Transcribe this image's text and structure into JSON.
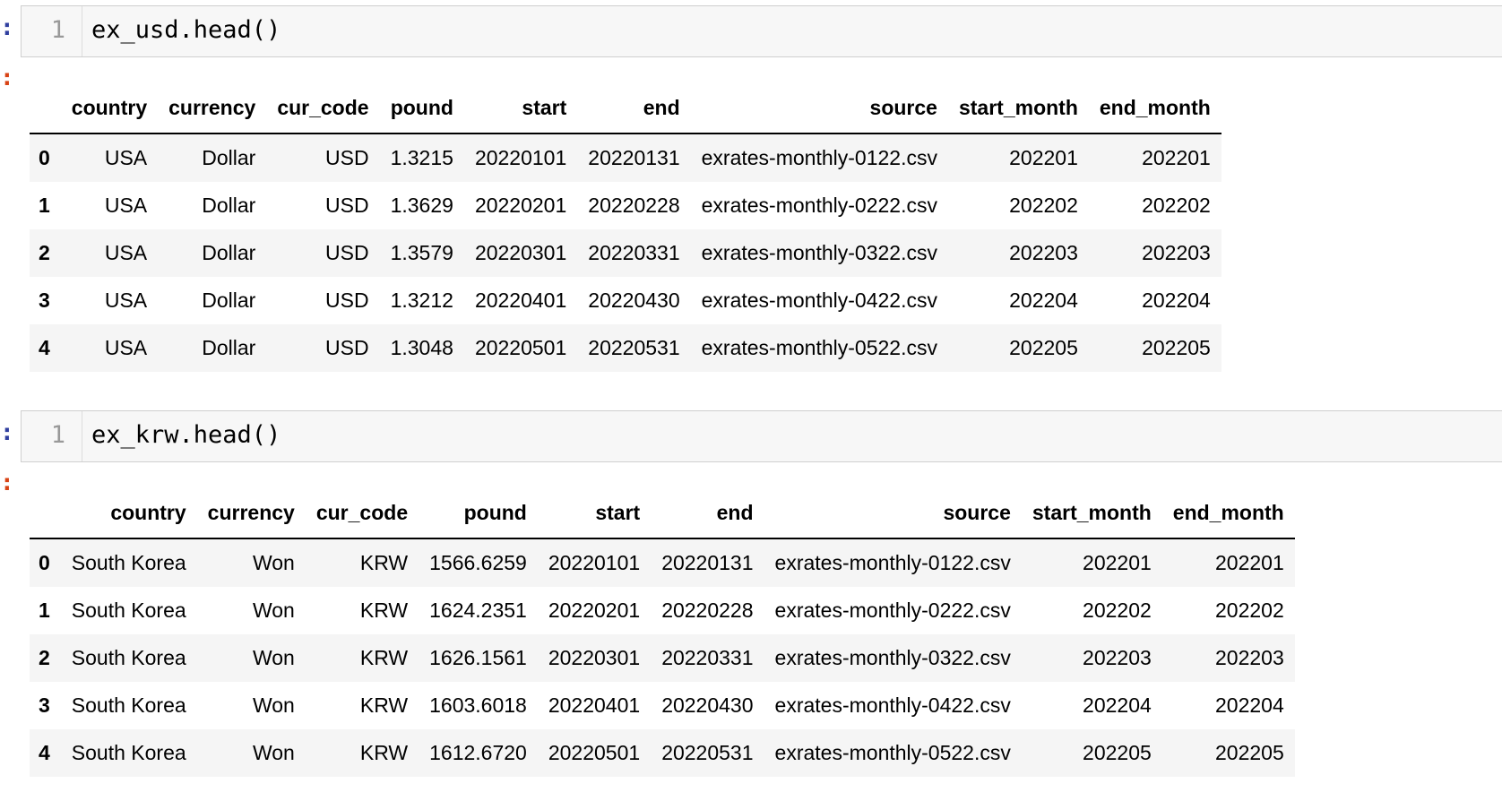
{
  "cells": [
    {
      "in_prompt": ":",
      "out_prompt": ":",
      "line_number": "1",
      "code": "ex_usd.head()",
      "table": {
        "columns": [
          "",
          "country",
          "currency",
          "cur_code",
          "pound",
          "start",
          "end",
          "source",
          "start_month",
          "end_month"
        ],
        "rows": [
          [
            "0",
            "USA",
            "Dollar",
            "USD",
            "1.3215",
            "20220101",
            "20220131",
            "exrates-monthly-0122.csv",
            "202201",
            "202201"
          ],
          [
            "1",
            "USA",
            "Dollar",
            "USD",
            "1.3629",
            "20220201",
            "20220228",
            "exrates-monthly-0222.csv",
            "202202",
            "202202"
          ],
          [
            "2",
            "USA",
            "Dollar",
            "USD",
            "1.3579",
            "20220301",
            "20220331",
            "exrates-monthly-0322.csv",
            "202203",
            "202203"
          ],
          [
            "3",
            "USA",
            "Dollar",
            "USD",
            "1.3212",
            "20220401",
            "20220430",
            "exrates-monthly-0422.csv",
            "202204",
            "202204"
          ],
          [
            "4",
            "USA",
            "Dollar",
            "USD",
            "1.3048",
            "20220501",
            "20220531",
            "exrates-monthly-0522.csv",
            "202205",
            "202205"
          ]
        ]
      }
    },
    {
      "in_prompt": ":",
      "out_prompt": ":",
      "line_number": "1",
      "code": "ex_krw.head()",
      "table": {
        "columns": [
          "",
          "country",
          "currency",
          "cur_code",
          "pound",
          "start",
          "end",
          "source",
          "start_month",
          "end_month"
        ],
        "rows": [
          [
            "0",
            "South Korea",
            "Won",
            "KRW",
            "1566.6259",
            "20220101",
            "20220131",
            "exrates-monthly-0122.csv",
            "202201",
            "202201"
          ],
          [
            "1",
            "South Korea",
            "Won",
            "KRW",
            "1624.2351",
            "20220201",
            "20220228",
            "exrates-monthly-0222.csv",
            "202202",
            "202202"
          ],
          [
            "2",
            "South Korea",
            "Won",
            "KRW",
            "1626.1561",
            "20220301",
            "20220331",
            "exrates-monthly-0322.csv",
            "202203",
            "202203"
          ],
          [
            "3",
            "South Korea",
            "Won",
            "KRW",
            "1603.6018",
            "20220401",
            "20220430",
            "exrates-monthly-0422.csv",
            "202204",
            "202204"
          ],
          [
            "4",
            "South Korea",
            "Won",
            "KRW",
            "1612.6720",
            "20220501",
            "20220531",
            "exrates-monthly-0522.csv",
            "202205",
            "202205"
          ]
        ]
      }
    }
  ],
  "colors": {
    "in_prompt": "#303f9f",
    "out_prompt": "#d84315",
    "cell_background": "#f7f7f7",
    "row_stripe": "#f5f5f5"
  }
}
